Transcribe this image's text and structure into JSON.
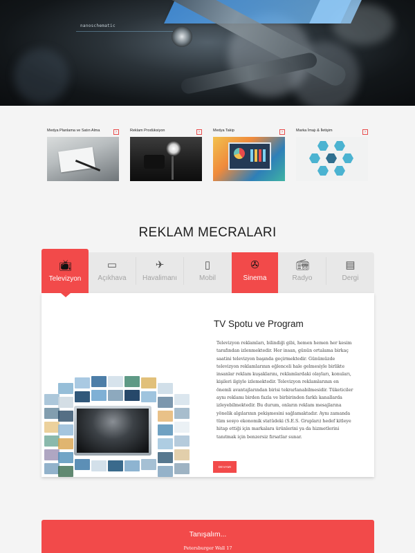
{
  "hero": {
    "tag": "nanoschematic"
  },
  "services": [
    {
      "title": "Medya Planlama ve Satın Alma",
      "image_icon": "document-pen-icon"
    },
    {
      "title": "Reklam Prodüksiyon",
      "image_icon": "film-camera-icon"
    },
    {
      "title": "Medya Takip",
      "image_icon": "monitor-analytics-icon"
    },
    {
      "title": "Marka İmajı & İletişim",
      "image_icon": "hexagon-network-icon"
    }
  ],
  "section_title": "REKLAM MECRALARI",
  "tabs": [
    {
      "label": "Televizyon",
      "icon": "tv-icon",
      "state": "active"
    },
    {
      "label": "Açıkhava",
      "icon": "billboard-icon",
      "state": "normal"
    },
    {
      "label": "Havalimanı",
      "icon": "airplane-icon",
      "state": "normal"
    },
    {
      "label": "Mobil",
      "icon": "mobile-icon",
      "state": "normal"
    },
    {
      "label": "Sinema",
      "icon": "film-reel-icon",
      "state": "hover"
    },
    {
      "label": "Radyo",
      "icon": "radio-icon",
      "state": "normal"
    },
    {
      "label": "Dergi",
      "icon": "magazine-icon",
      "state": "normal"
    }
  ],
  "panel": {
    "title": "TV Spotu ve Program",
    "body": "Televizyon reklamları, bilindiği gibi, hemen hemen her kesim tarafından izlenmektedir. Her insan, günün ortalama birkaç saatini televizyon başında geçirmektedir. Günümüzde televizyon reklamlarının eğlenceli hale gelmesiyle birlikte insanlar reklam kuşaklarını, reklamlardaki olayları, konuları, kişileri ilgiyle izlemektedir. Televizyon reklamlarının en önemli avantajlarından birisi tekrarlanabilmesidir. Tüketiciler aynı reklamı birden fazla ve birbirinden farklı kanallarda izleyebilmektedir. Bu durum, onların reklam mesajlarına yönelik algılarının pekişmesini sağlamaktadır. Aynı zamanda tüm sosyo ekonomik statüdeki (S.E.S. Grupları) hedef kitleye hitap ettiği için markalara ürünlerini ya da hizmetlerini tanıtmak için benzersiz fırsatlar sunar.",
    "button": "DEVAMI"
  },
  "contact": {
    "title": "Tanışalım...",
    "address": "Petersburger Wall 17"
  },
  "colors": {
    "accent": "#f24a4a",
    "background": "#f4f4f4",
    "tab_bg": "#e8e8e8"
  }
}
